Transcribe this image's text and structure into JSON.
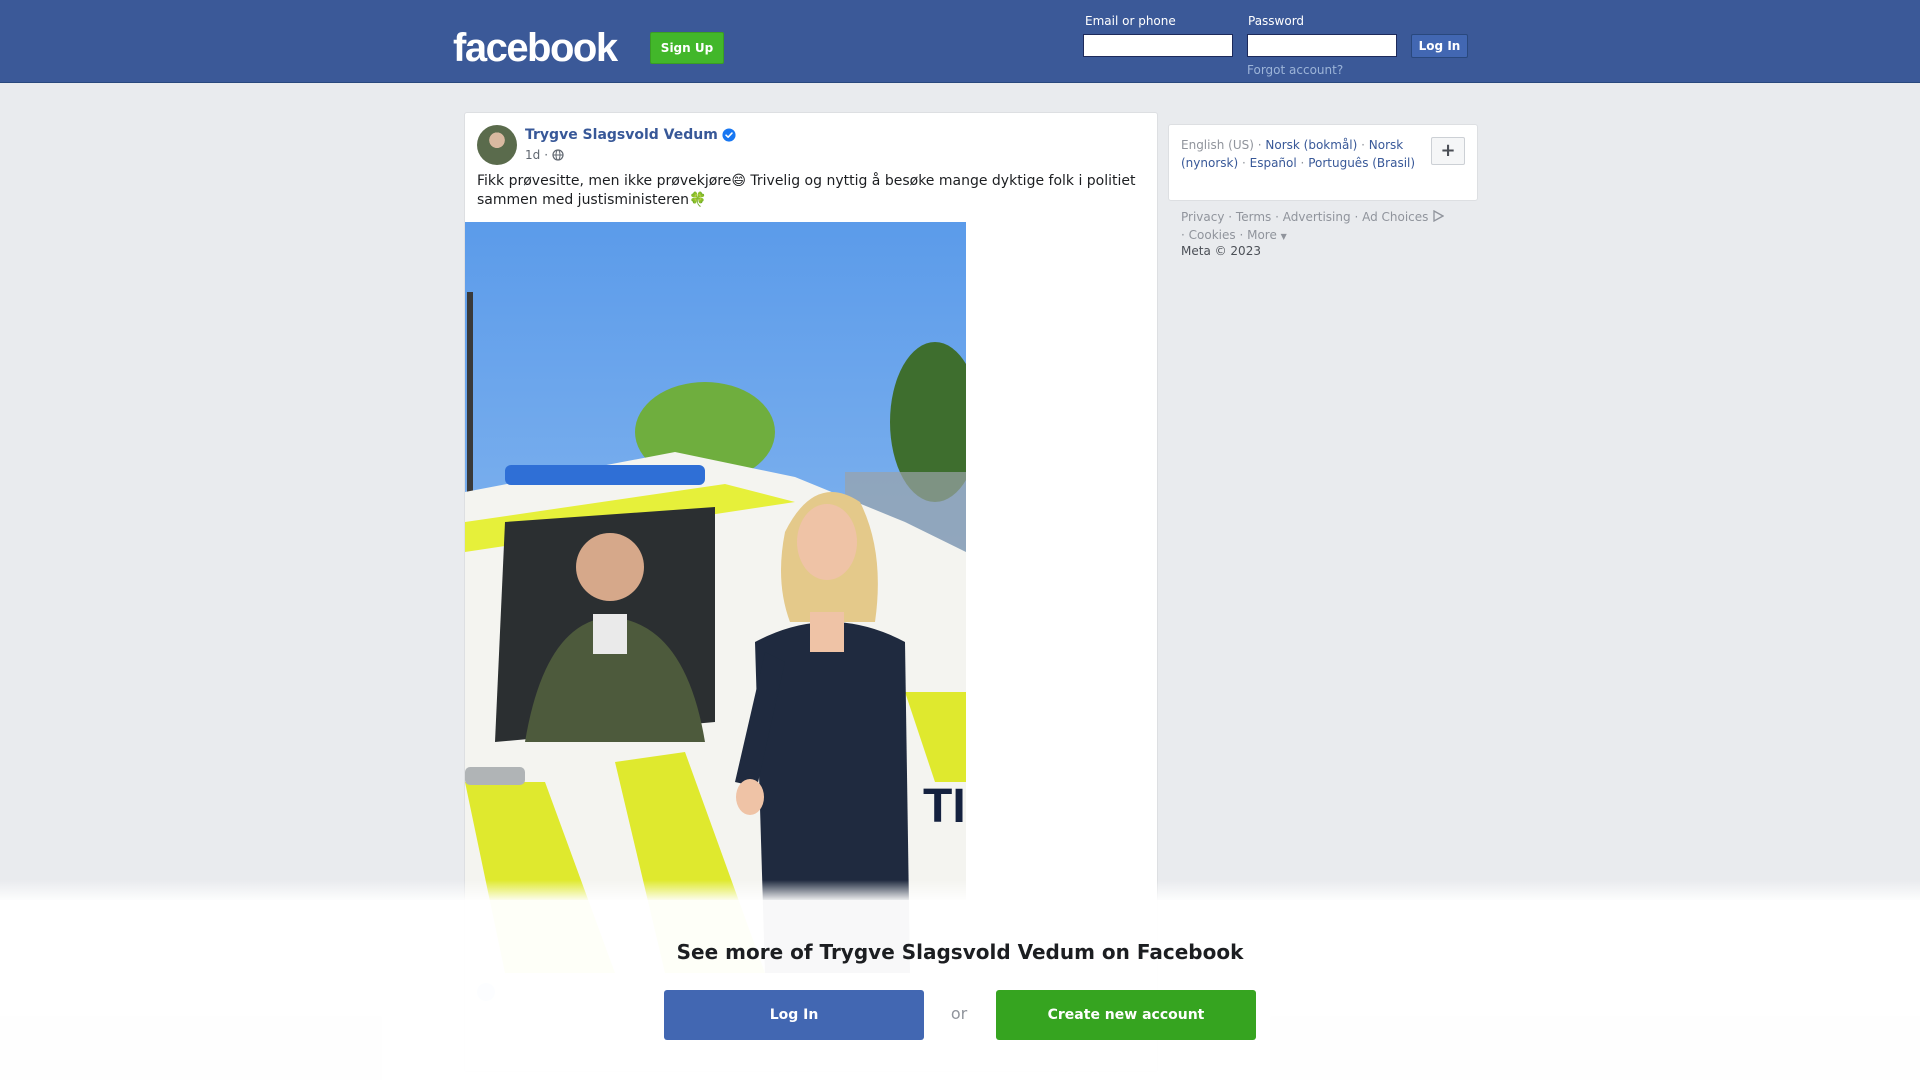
{
  "header": {
    "logo_text": "facebook",
    "signup_label": "Sign Up",
    "email_label": "Email or phone",
    "password_label": "Password",
    "login_label": "Log In",
    "forgot_label": "Forgot account?",
    "brand_color": "#3b5998"
  },
  "post": {
    "author": "Trygve Slagsvold Vedum",
    "verified_icon": "verified-badge-icon",
    "time": "1d",
    "privacy_icon": "globe-icon",
    "text": "Fikk prøvesitte, men ikke prøvekjøre😄 Trivelig og nyttig å besøke mange dyktige folk i politiet sammen med justisministeren🍀",
    "photo_alt": "Photo of two people at a police car"
  },
  "sidebar": {
    "languages": [
      {
        "label": "English (US)",
        "current": true
      },
      {
        "label": "Norsk (bokmål)",
        "current": false
      },
      {
        "label": "Norsk (nynorsk)",
        "current": false
      },
      {
        "label": "Español",
        "current": false
      },
      {
        "label": "Português (Brasil)",
        "current": false
      }
    ],
    "plus_label": "+",
    "footer": {
      "privacy": "Privacy",
      "terms": "Terms",
      "advertising": "Advertising",
      "ad_choices": "Ad Choices",
      "cookies": "Cookies",
      "more": "More",
      "copyright": "Meta © 2023"
    }
  },
  "banner": {
    "title": "See more of Trygve Slagsvold Vedum on Facebook",
    "login_label": "Log In",
    "or_label": "or",
    "create_label": "Create new account"
  }
}
